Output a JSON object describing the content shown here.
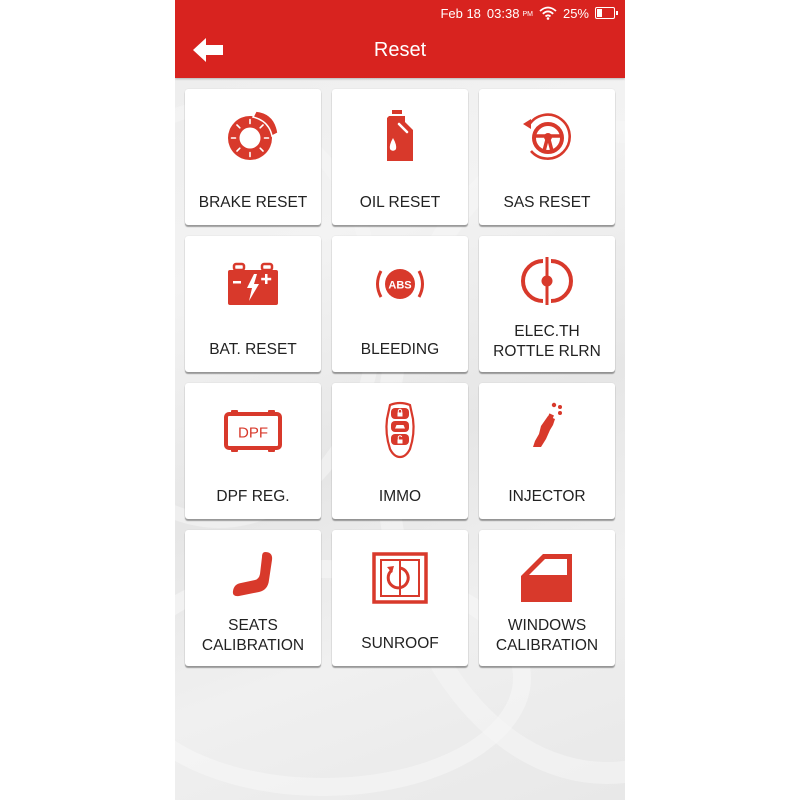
{
  "status_bar": {
    "date": "Feb 18",
    "time": "03:38",
    "ampm": "PM",
    "wifi_icon": "wifi-icon",
    "battery_percent": "25%",
    "battery_level": 0.25
  },
  "header": {
    "back_icon": "arrow-left-icon",
    "title": "Reset",
    "accent_color": "#d8231f"
  },
  "tiles": [
    {
      "label": "BRAKE RESET",
      "icon": "brake-disc-icon"
    },
    {
      "label": "OIL RESET",
      "icon": "oil-can-icon"
    },
    {
      "label": "SAS RESET",
      "icon": "steering-wheel-reset-icon"
    },
    {
      "label": "BAT. RESET",
      "icon": "battery-charge-icon"
    },
    {
      "label": "BLEEDING",
      "icon": "abs-warning-icon",
      "icon_text": "ABS"
    },
    {
      "label": "ELEC.TH ROTTLE RLRN",
      "icon": "throttle-icon"
    },
    {
      "label": "DPF REG.",
      "icon": "dpf-icon",
      "icon_text": "DPF"
    },
    {
      "label": "IMMO",
      "icon": "car-key-fob-icon"
    },
    {
      "label": "INJECTOR",
      "icon": "injector-icon"
    },
    {
      "label": "SEATS CALIBRATION",
      "icon": "seat-icon"
    },
    {
      "label": "SUNROOF",
      "icon": "sunroof-icon"
    },
    {
      "label": "WINDOWS CALIBRATION",
      "icon": "car-door-window-icon"
    }
  ]
}
